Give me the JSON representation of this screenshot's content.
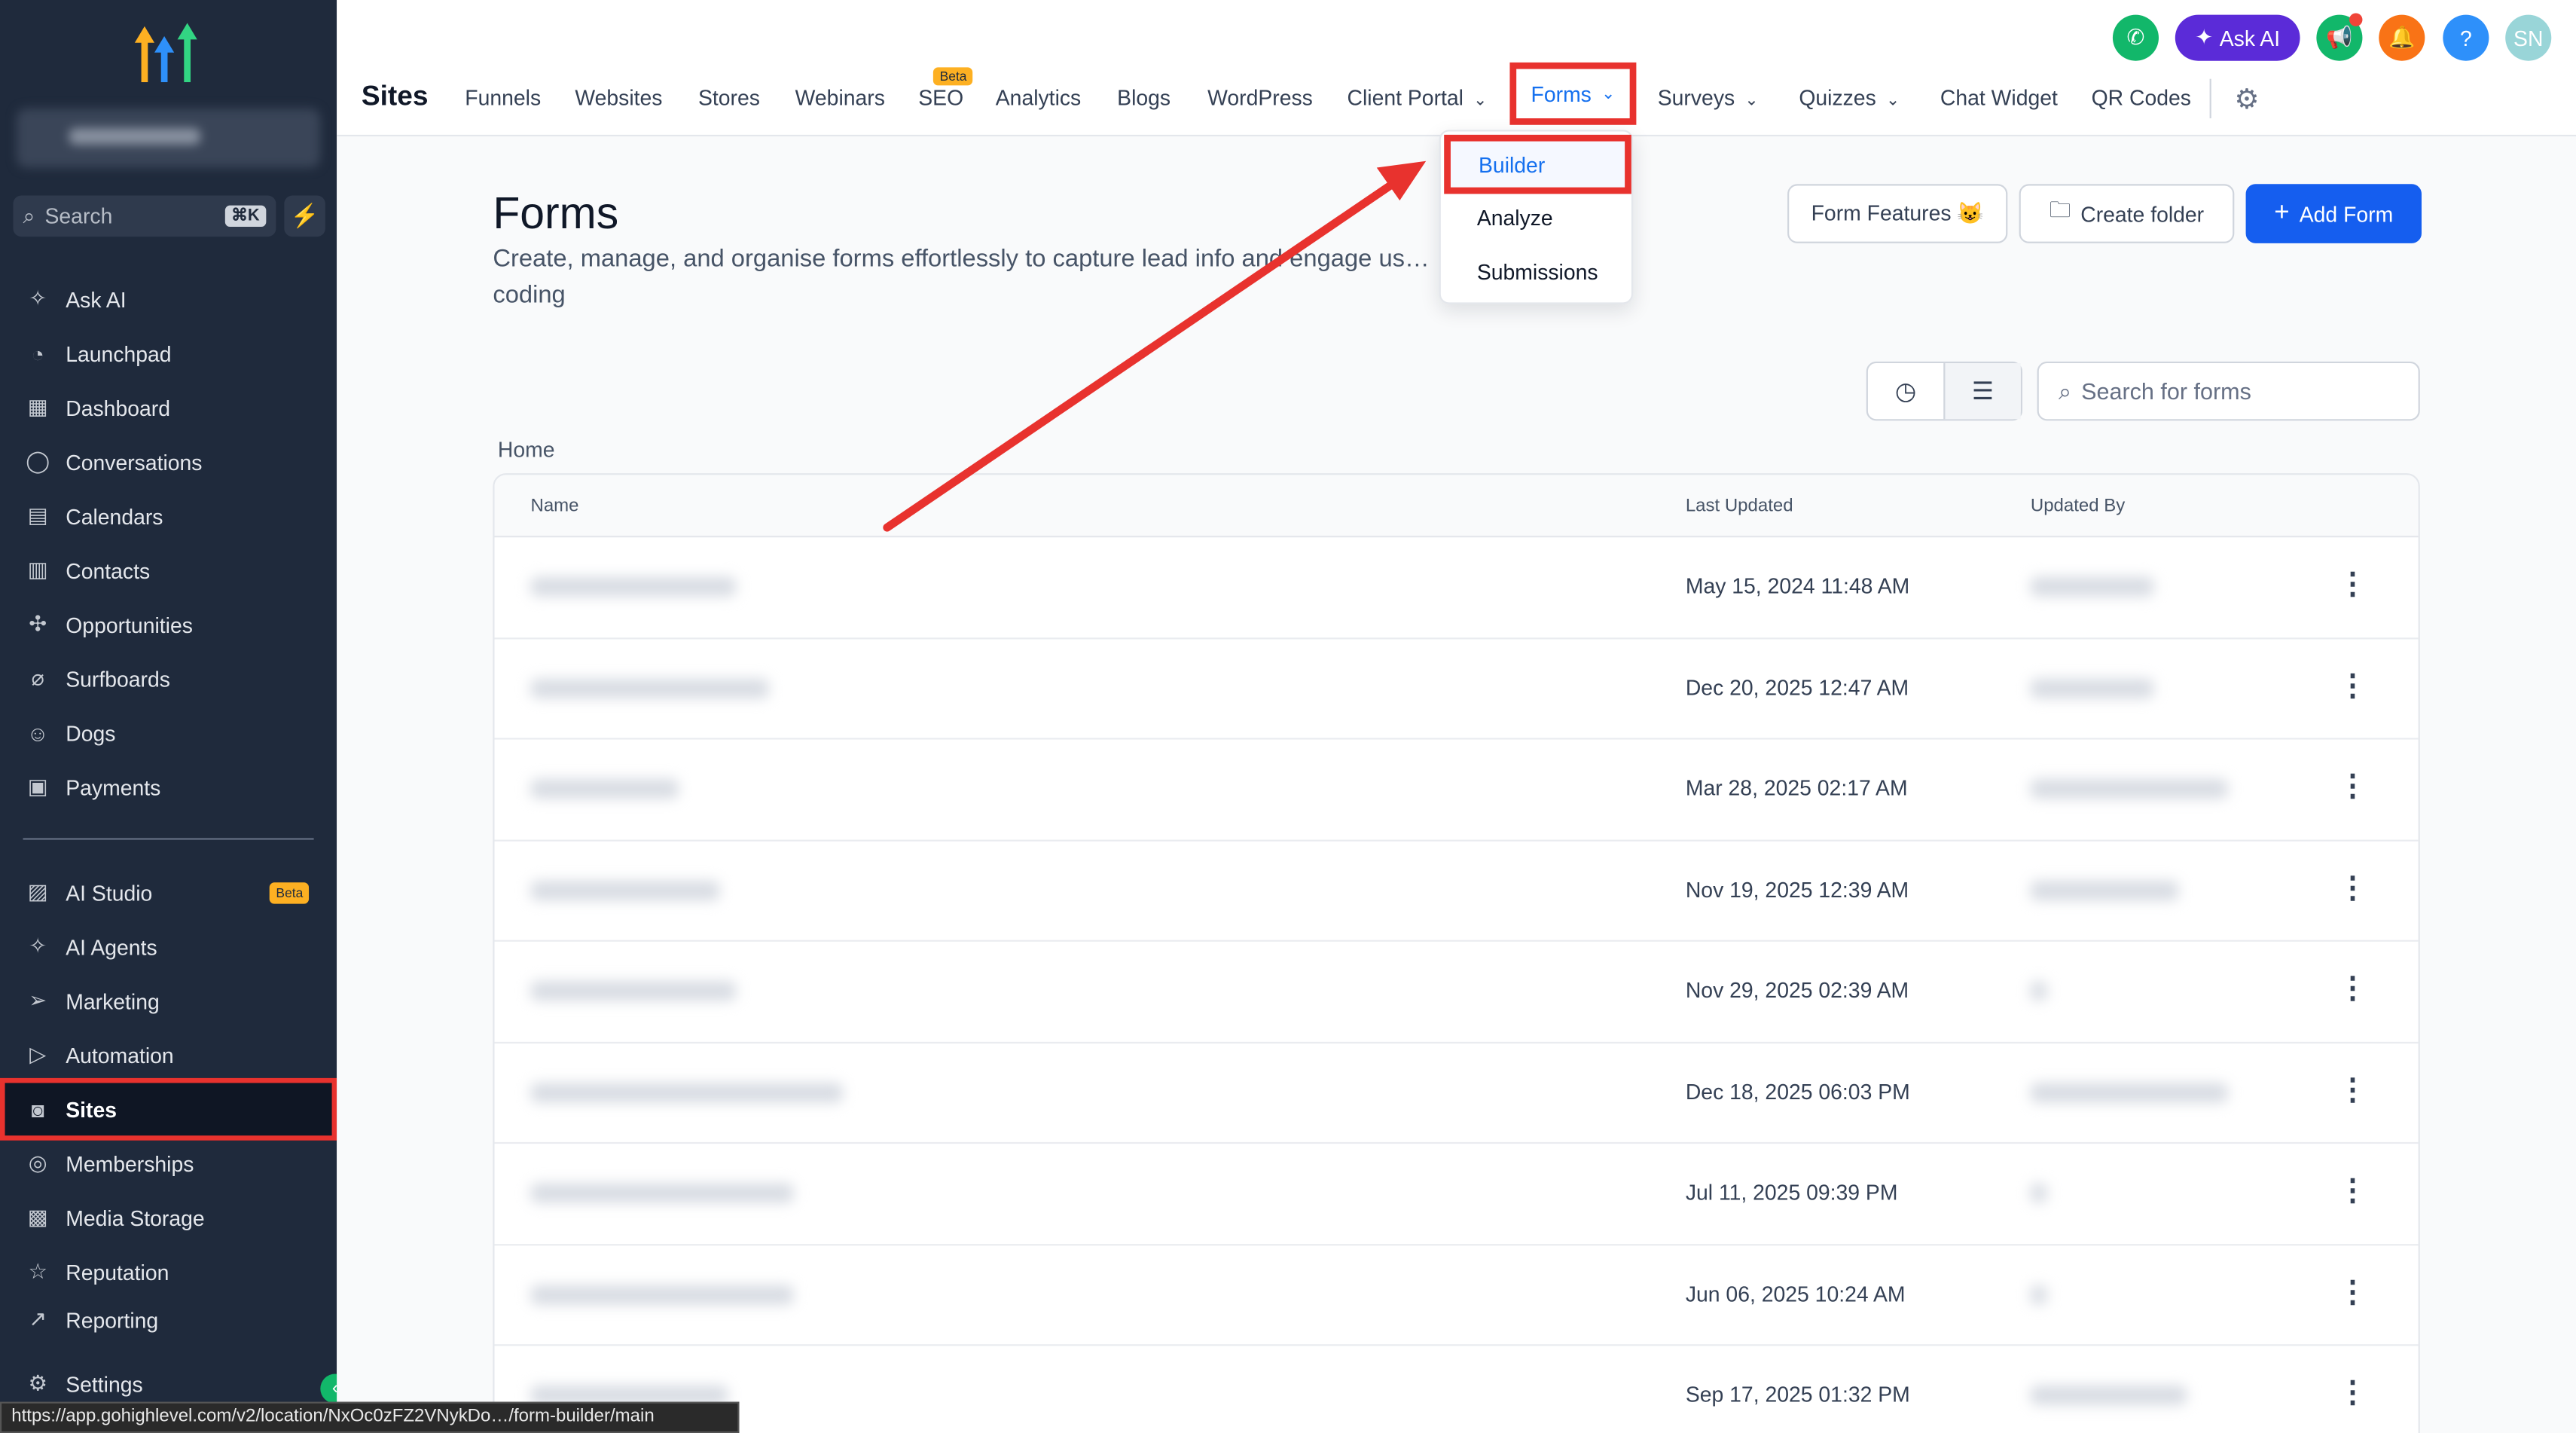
{
  "sidebar": {
    "account_name": "",
    "search_placeholder": "Search",
    "search_shortcut": "⌘K",
    "items_top": [
      {
        "label": "Ask AI",
        "icon": "sparkle-icon"
      },
      {
        "label": "Launchpad",
        "icon": "rocket-icon"
      },
      {
        "label": "Dashboard",
        "icon": "grid-icon"
      },
      {
        "label": "Conversations",
        "icon": "chat-icon"
      },
      {
        "label": "Calendars",
        "icon": "calendar-icon"
      },
      {
        "label": "Contacts",
        "icon": "contacts-icon"
      },
      {
        "label": "Opportunities",
        "icon": "opportunities-icon"
      },
      {
        "label": "Surfboards",
        "icon": "surfboard-icon"
      },
      {
        "label": "Dogs",
        "icon": "dog-icon"
      },
      {
        "label": "Payments",
        "icon": "receipt-icon"
      }
    ],
    "items_bottom": [
      {
        "label": "AI Studio",
        "icon": "ai-studio-icon"
      },
      {
        "label": "AI Agents",
        "icon": "sparkle-icon"
      },
      {
        "label": "Marketing",
        "icon": "send-icon"
      },
      {
        "label": "Automation",
        "icon": "automation-icon"
      },
      {
        "label": "Sites",
        "icon": "sites-icon"
      },
      {
        "label": "Memberships",
        "icon": "award-icon"
      },
      {
        "label": "Media Storage",
        "icon": "image-icon"
      },
      {
        "label": "Reputation",
        "icon": "star-icon"
      },
      {
        "label": "Reporting",
        "icon": "trend-icon"
      }
    ],
    "ai_studio_badge": "Beta",
    "settings_label": "Settings"
  },
  "status_url": "https://app.gohighlevel.com/v2/location/NxOc0zFZ2VNykDo…/form-builder/main",
  "topnav": {
    "section_title": "Sites",
    "tabs": [
      "Funnels",
      "Websites",
      "Stores",
      "Webinars",
      "SEO",
      "Analytics",
      "Blogs",
      "WordPress",
      "Client Portal",
      "Forms",
      "Surveys",
      "Quizzes",
      "Chat Widget",
      "QR Codes"
    ],
    "seo_badge": "Beta",
    "ask_ai": "Ask AI",
    "avatar_initials": "SN",
    "help": "?"
  },
  "forms_menu": {
    "items": [
      "Builder",
      "Analyze",
      "Submissions"
    ],
    "active": "Builder"
  },
  "page": {
    "title": "Forms",
    "subtitle": "Create, manage, and organise forms effortlessly to capture lead info and engage us…",
    "subtitle_line2": "coding",
    "btn_features": "Form Features 😺",
    "btn_create_folder": "Create folder",
    "btn_add_form": "Add Form",
    "search_placeholder": "Search for forms",
    "breadcrumb": "Home"
  },
  "table": {
    "columns": [
      "Name",
      "Last Updated",
      "Updated By"
    ],
    "rows": [
      {
        "updated": "May 15, 2024 11:48 AM"
      },
      {
        "updated": "Dec 20, 2025 12:47 AM"
      },
      {
        "updated": "Mar 28, 2025 02:17 AM"
      },
      {
        "updated": "Nov 19, 2025 12:39 AM"
      },
      {
        "updated": "Nov 29, 2025 02:39 AM"
      },
      {
        "updated": "Dec 18, 2025 06:03 PM"
      },
      {
        "updated": "Jul 11, 2025 09:39 PM"
      },
      {
        "updated": "Jun 06, 2025 10:24 AM"
      },
      {
        "updated": "Sep 17, 2025 01:32 PM"
      }
    ]
  },
  "colors": {
    "sidebar_bg": "#1f2a3c",
    "highlight": "#e8322e",
    "primary": "#155eef",
    "link": "#1570ef"
  }
}
